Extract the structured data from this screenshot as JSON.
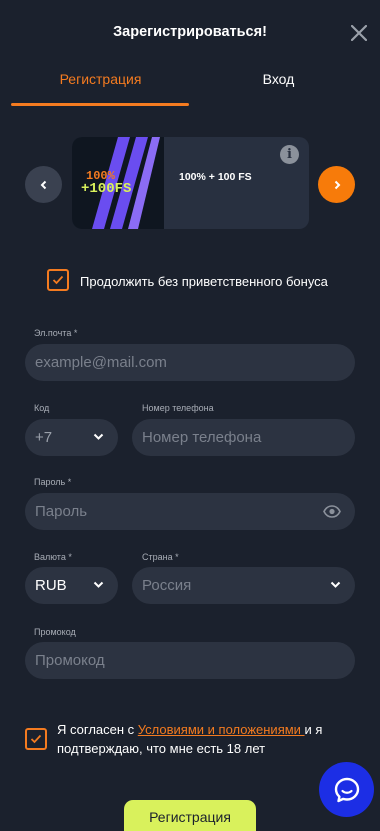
{
  "header": {
    "title": "Зарегистрироваться!"
  },
  "tabs": [
    {
      "label": "Регистрация",
      "active": true
    },
    {
      "label": "Вход",
      "active": false
    }
  ],
  "bonus": {
    "image_text_line1": "100%",
    "image_text_line2": "+100FS",
    "title": "100% + 100 FS",
    "info": "i"
  },
  "skip_bonus_label": "Продолжить без приветственного бонуса",
  "form": {
    "email": {
      "label": "Эл.почта *",
      "placeholder": "example@mail.com"
    },
    "code": {
      "label": "Код",
      "value": "+7"
    },
    "phone": {
      "label": "Номер телефона",
      "placeholder": "Номер телефона"
    },
    "password": {
      "label": "Пароль *",
      "placeholder": "Пароль"
    },
    "currency": {
      "label": "Валюта *",
      "value": "RUB"
    },
    "country": {
      "label": "Страна *",
      "value": "Россия"
    },
    "promo": {
      "label": "Промокод",
      "placeholder": "Промокод"
    }
  },
  "consent": {
    "prefix": "Я согласен с ",
    "link": "Условиями и положениями ",
    "suffix": "и я подтверждаю, что мне есть 18 лет"
  },
  "submit_label": "Регистрация",
  "colors": {
    "accent": "#f47b20",
    "background": "#1b212d",
    "field": "#2c3341",
    "submit": "#d9f15c",
    "chat": "#1c2ee5"
  }
}
